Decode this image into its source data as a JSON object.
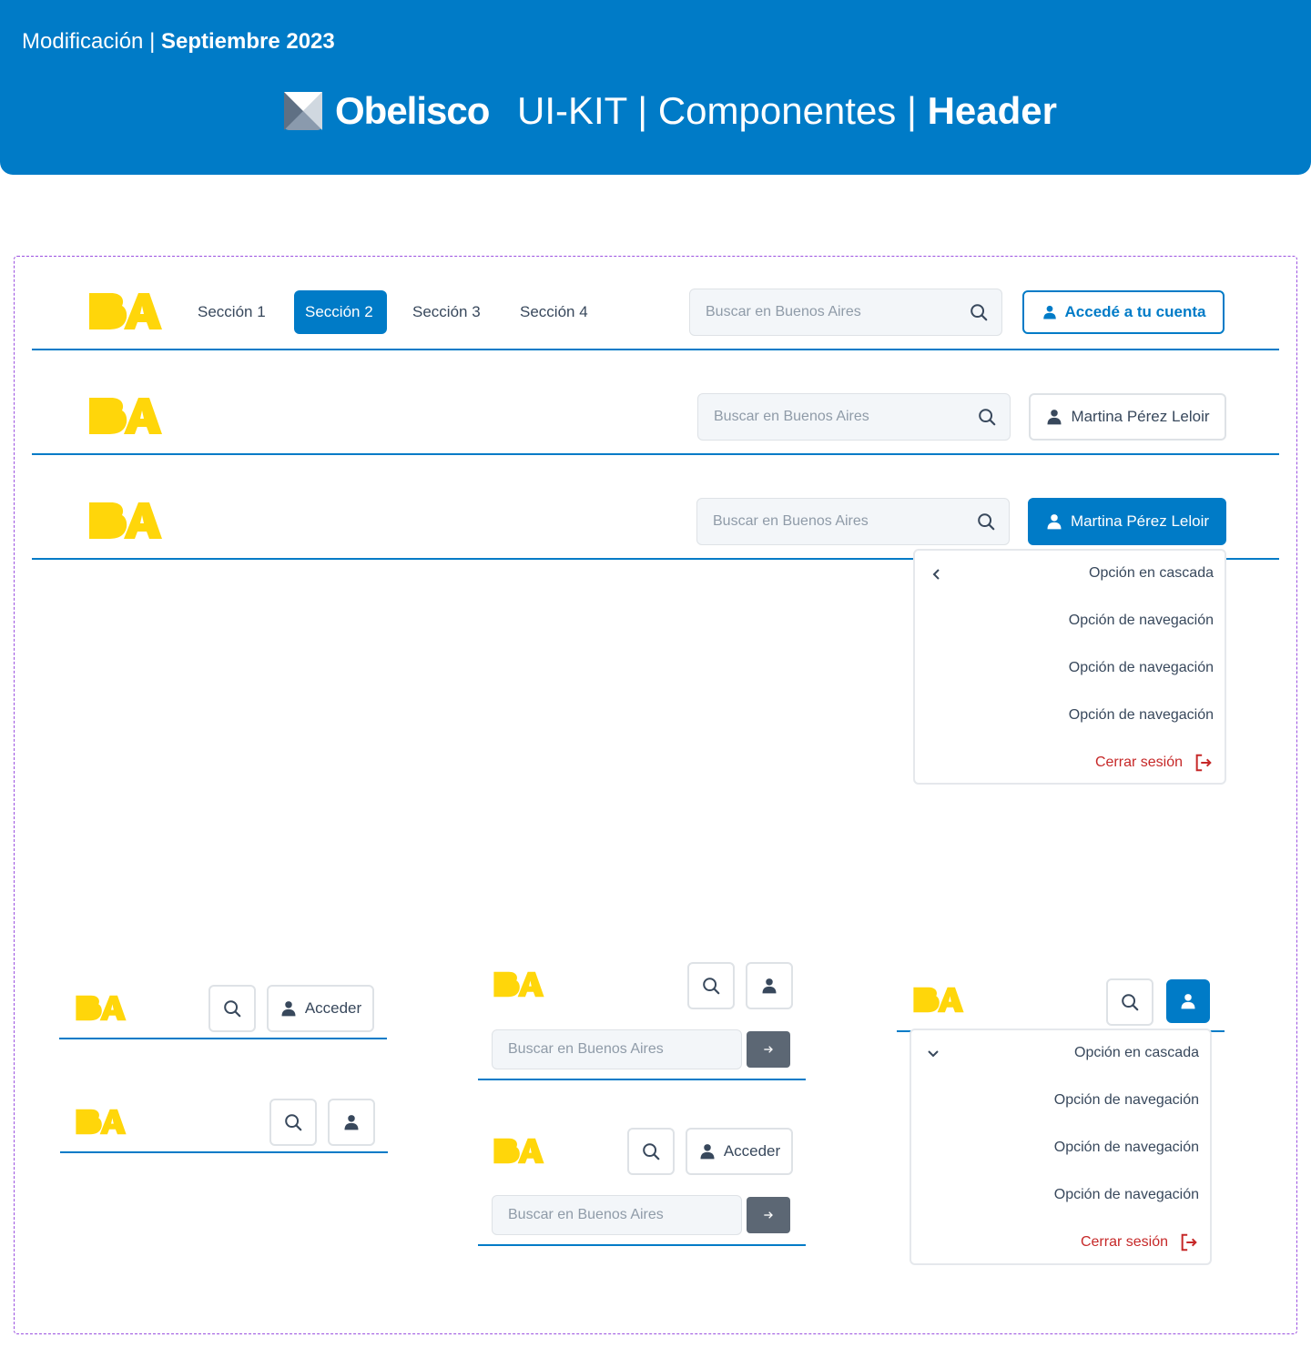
{
  "banner": {
    "modified_label": "Modificación | ",
    "modified_date": "Septiembre 2023",
    "brand": "Obelisco",
    "title_prefix": "UI-KIT | Componentes | ",
    "title_bold": "Header"
  },
  "header1": {
    "nav": [
      "Sección 1",
      "Sección 2",
      "Sección 3",
      "Sección 4"
    ],
    "active_index": 1,
    "search_placeholder": "Buscar en Buenos Aires",
    "account_button": "Accedé a tu cuenta"
  },
  "header2": {
    "search_placeholder": "Buscar en Buenos Aires",
    "user_name": "Martina Pérez Leloir"
  },
  "header3": {
    "search_placeholder": "Buscar en Buenos Aires",
    "user_name": "Martina Pérez Leloir",
    "menu": {
      "cascade": "Opción en cascada",
      "items": [
        "Opción de navegación",
        "Opción de navegación",
        "Opción de navegación"
      ],
      "logout": "Cerrar sesión"
    }
  },
  "mobile": {
    "access_label": "Acceder",
    "search_placeholder": "Buscar en Buenos Aires",
    "menu": {
      "cascade": "Opción en cascada",
      "items": [
        "Opción de navegación",
        "Opción de navegación",
        "Opción de navegación"
      ],
      "logout": "Cerrar sesión"
    }
  },
  "colors": {
    "primary": "#007bc7",
    "logo_yellow": "#ffd60a",
    "danger": "#c62828",
    "frame": "#9b51e0"
  }
}
